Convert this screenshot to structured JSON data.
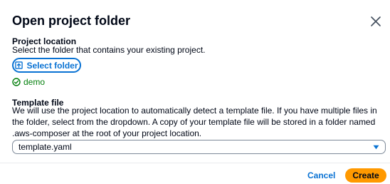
{
  "dialog": {
    "title": "Open project folder",
    "close_icon": "close-icon"
  },
  "project_location": {
    "label": "Project location",
    "description": "Select the folder that contains your existing project.",
    "button_label": "Select folder",
    "button_icon": "upload-icon",
    "selected_folder": "demo",
    "status_icon": "check-circle-icon"
  },
  "template_file": {
    "label": "Template file",
    "description": "We will use the project location to automatically detect a template file. If you have multiple files in the folder, select from the dropdown. A copy of your template file will be stored in a folder named .aws-composer at the root of your project location.",
    "selected_value": "template.yaml",
    "caret_icon": "caret-down-icon"
  },
  "footer": {
    "cancel_label": "Cancel",
    "create_label": "Create"
  },
  "colors": {
    "accent": "#0972d3",
    "primary_button": "#ff9900",
    "success": "#037f0c",
    "text": "#000716"
  }
}
